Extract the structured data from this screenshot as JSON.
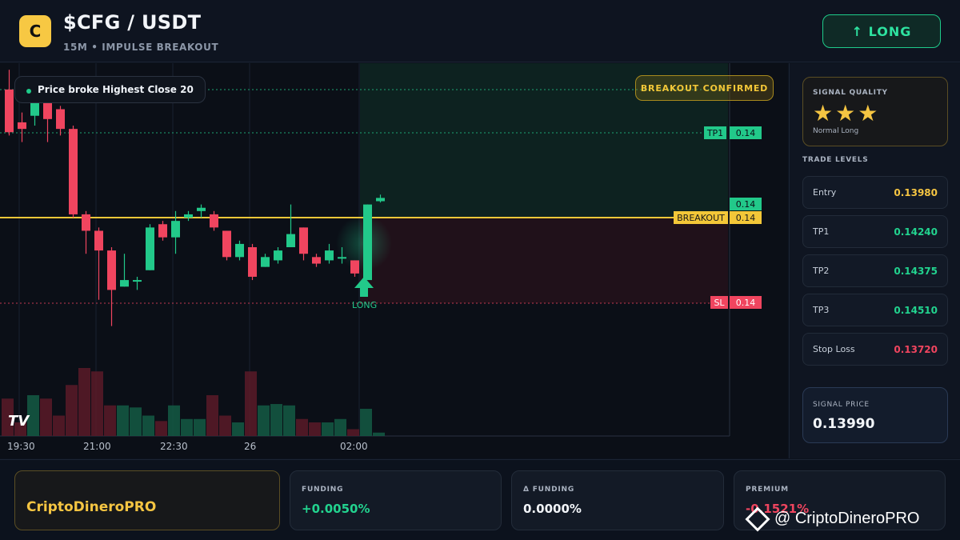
{
  "header": {
    "logo_letter": "C",
    "title": "$CFG / USDT",
    "subtitle": "15M • IMPULSE BREAKOUT",
    "long_button": "↑ LONG"
  },
  "chart": {
    "info_pill": "Price broke Highest Close 20",
    "banner": "BREAKOUT CONFIRMED",
    "signal_label": "LONG",
    "tv_logo": "TV",
    "levels": [
      {
        "name": "TP1",
        "value": "0.14"
      },
      {
        "name": "",
        "value": "0.14"
      },
      {
        "name": "BREAKOUT",
        "value": "0.14"
      },
      {
        "name": "SL",
        "value": "0.14"
      }
    ],
    "time_labels": [
      "19:30",
      "21:00",
      "22:30",
      "26",
      "02:00"
    ]
  },
  "side": {
    "quality_label": "SIGNAL QUALITY",
    "stars": "★★★",
    "quality_sub": "Normal Long",
    "levels_title": "TRADE LEVELS",
    "levels": [
      {
        "name": "Entry",
        "value": "0.13980",
        "color": "#f5c542"
      },
      {
        "name": "TP1",
        "value": "0.14240",
        "color": "#22d38f"
      },
      {
        "name": "TP2",
        "value": "0.14375",
        "color": "#22d38f"
      },
      {
        "name": "TP3",
        "value": "0.14510",
        "color": "#22d38f"
      },
      {
        "name": "Stop Loss",
        "value": "0.13720",
        "color": "#f0455f"
      }
    ],
    "signal_price_label": "SIGNAL PRICE",
    "signal_price": "0.13990"
  },
  "footer": {
    "brand": "CriptoDineroPRO",
    "funding_label": "FUNDING",
    "funding_value": "+0.0050%",
    "dfunding_label": "Δ FUNDING",
    "dfunding_value": "0.0000%",
    "premium_label": "PREMIUM",
    "premium_value": "-0.1521%",
    "watermark": "@ CriptoDineroPRO"
  },
  "colors": {
    "up": "#22c98a",
    "down": "#f0455f",
    "breakout": "#f3c738"
  },
  "candles": [
    {
      "o": 0.1412,
      "h": 0.1415,
      "l": 0.1405,
      "c": 0.14055
    },
    {
      "o": 0.1407,
      "h": 0.14085,
      "l": 0.1404,
      "c": 0.1406
    },
    {
      "o": 0.1408,
      "h": 0.14115,
      "l": 0.14065,
      "c": 0.1411
    },
    {
      "o": 0.1411,
      "h": 0.1412,
      "l": 0.1404,
      "c": 0.14075
    },
    {
      "o": 0.1409,
      "h": 0.14095,
      "l": 0.1405,
      "c": 0.1406
    },
    {
      "o": 0.1406,
      "h": 0.14065,
      "l": 0.13925,
      "c": 0.1393
    },
    {
      "o": 0.1393,
      "h": 0.13935,
      "l": 0.1387,
      "c": 0.13905
    },
    {
      "o": 0.13905,
      "h": 0.1391,
      "l": 0.138,
      "c": 0.13875
    },
    {
      "o": 0.13875,
      "h": 0.1388,
      "l": 0.1376,
      "c": 0.13815
    },
    {
      "o": 0.1382,
      "h": 0.1387,
      "l": 0.1382,
      "c": 0.1383
    },
    {
      "o": 0.1383,
      "h": 0.13835,
      "l": 0.13815,
      "c": 0.1383
    },
    {
      "o": 0.13845,
      "h": 0.13915,
      "l": 0.13845,
      "c": 0.1391
    },
    {
      "o": 0.13915,
      "h": 0.1392,
      "l": 0.1389,
      "c": 0.13895
    },
    {
      "o": 0.13895,
      "h": 0.13935,
      "l": 0.1387,
      "c": 0.1392
    },
    {
      "o": 0.13925,
      "h": 0.13935,
      "l": 0.1392,
      "c": 0.1393
    },
    {
      "o": 0.13935,
      "h": 0.13945,
      "l": 0.13925,
      "c": 0.1394
    },
    {
      "o": 0.1393,
      "h": 0.13935,
      "l": 0.13905,
      "c": 0.1391
    },
    {
      "o": 0.13905,
      "h": 0.13905,
      "l": 0.1386,
      "c": 0.13865
    },
    {
      "o": 0.13865,
      "h": 0.1389,
      "l": 0.1386,
      "c": 0.13885
    },
    {
      "o": 0.1388,
      "h": 0.13885,
      "l": 0.1383,
      "c": 0.13835
    },
    {
      "o": 0.1385,
      "h": 0.1387,
      "l": 0.1385,
      "c": 0.13865
    },
    {
      "o": 0.1386,
      "h": 0.1388,
      "l": 0.13855,
      "c": 0.13875
    },
    {
      "o": 0.1388,
      "h": 0.13945,
      "l": 0.1388,
      "c": 0.139
    },
    {
      "o": 0.1391,
      "h": 0.1391,
      "l": 0.1386,
      "c": 0.1387
    },
    {
      "o": 0.13865,
      "h": 0.1387,
      "l": 0.1385,
      "c": 0.13855
    },
    {
      "o": 0.1386,
      "h": 0.13885,
      "l": 0.13855,
      "c": 0.13875
    },
    {
      "o": 0.13865,
      "h": 0.1388,
      "l": 0.13855,
      "c": 0.13865
    },
    {
      "o": 0.1386,
      "h": 0.1386,
      "l": 0.13835,
      "c": 0.1384
    },
    {
      "o": 0.1383,
      "h": 0.13945,
      "l": 0.1383,
      "c": 0.13945
    },
    {
      "o": 0.1395,
      "h": 0.1396,
      "l": 0.13948,
      "c": 0.13955
    }
  ],
  "volumes": [
    0.55,
    0.2,
    0.6,
    0.55,
    0.3,
    0.75,
    1.0,
    0.95,
    0.45,
    0.45,
    0.42,
    0.3,
    0.22,
    0.45,
    0.25,
    0.25,
    0.6,
    0.3,
    0.2,
    0.95,
    0.45,
    0.47,
    0.45,
    0.25,
    0.2,
    0.2,
    0.25,
    0.1,
    0.4,
    0.05
  ],
  "price_scale": {
    "top": 0.1416,
    "bottom": 0.1374
  }
}
